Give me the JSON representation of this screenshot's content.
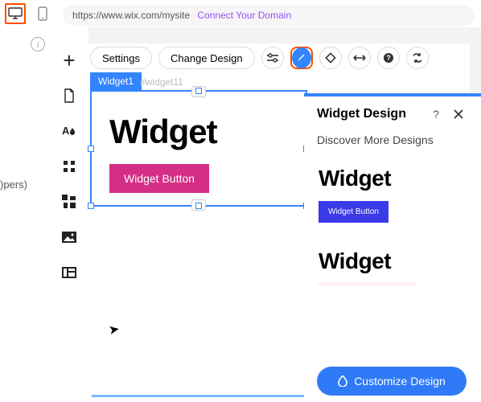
{
  "topbar": {
    "url": "https://www.wix.com/mysite",
    "connect_link": "Connect Your Domain"
  },
  "left_strip": {
    "truncated_label": ")pers)"
  },
  "toolbar": {
    "settings_label": "Settings",
    "change_design_label": "Change Design"
  },
  "canvas": {
    "tab_label": "Widget1",
    "element_id": "#widget11",
    "widget_heading": "Widget",
    "widget_button_label": "Widget Button"
  },
  "panel": {
    "title": "Widget Design",
    "subtitle": "Discover More Designs",
    "preset1": {
      "heading": "Widget",
      "button_label": "Widget Button"
    },
    "preset2": {
      "heading": "Widget"
    },
    "customize_label": "Customize Design"
  }
}
